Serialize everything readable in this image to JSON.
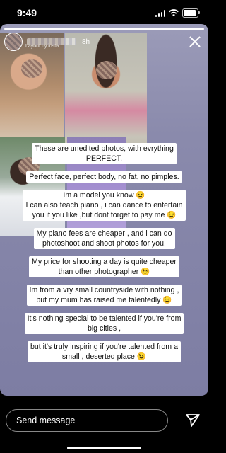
{
  "status_bar": {
    "time": "9:49",
    "battery_level": 0.9
  },
  "story": {
    "progress": 1.0,
    "timestamp": "8h",
    "layout_label": "Layout by insta",
    "captions": [
      "These are unedited photos, with evrything\nPERFECT.",
      "Perfect face, perfect body, no fat, no pimples.",
      "Im a model you know 😉\nI can also teach piano , i can dance to entertain\nyou if you like ,but dont forget to pay me 😉",
      "My piano fees are cheaper , and i can do\nphotoshoot and shoot photos for you.",
      "My price for shooting a day is quite cheaper\nthan other photographer 😉",
      "Im from a vry small countryside with nothing ,\nbut my mum has raised me talentedly 😉",
      "It's nothing special to be talented if you're from\nbig cities ,",
      "but it's truly inspiring if you're talented from a\nsmall , deserted place 😉"
    ]
  },
  "reply": {
    "placeholder": "Send message"
  },
  "icons": {
    "close": "close-icon",
    "send": "send-icon",
    "signal": "signal-icon",
    "wifi": "wifi-icon",
    "battery": "battery-icon"
  }
}
